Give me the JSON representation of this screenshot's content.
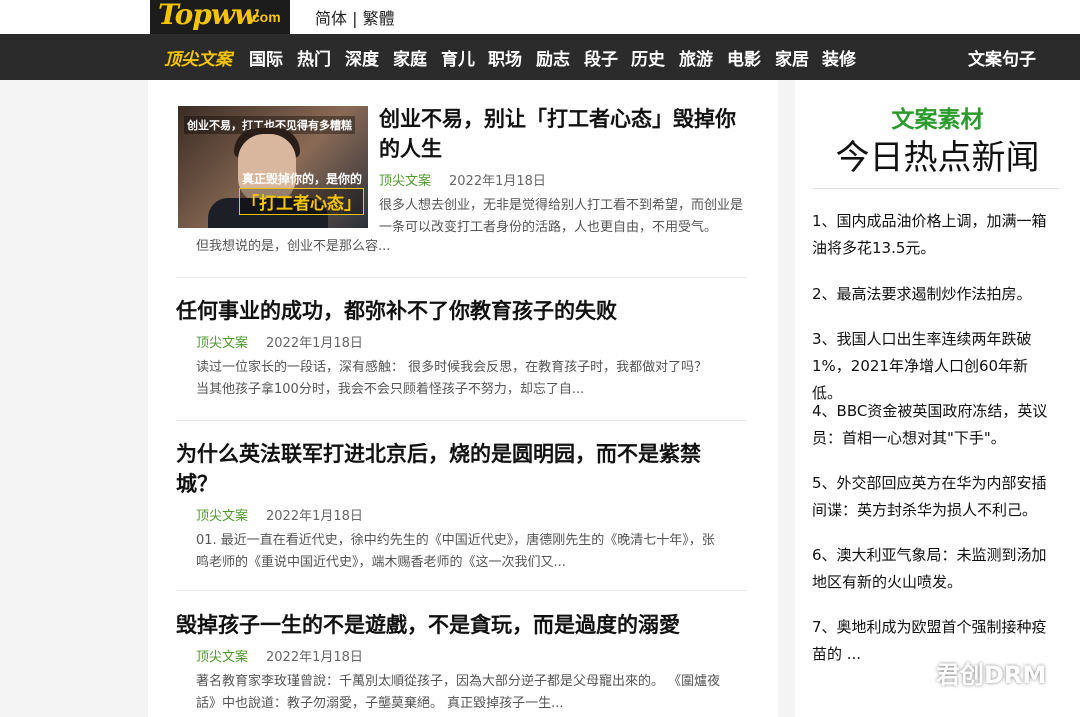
{
  "logo": {
    "main": "Topww",
    "suffix": ".com"
  },
  "language": {
    "simplified": "简体",
    "separator": " | ",
    "traditional": "繁體"
  },
  "nav": {
    "brand": "顶尖文案",
    "items": [
      "国际",
      "热门",
      "深度",
      "家庭",
      "育儿",
      "职场",
      "励志",
      "段子",
      "历史",
      "旅游",
      "电影",
      "家居",
      "装修"
    ],
    "right": "文案句子"
  },
  "thumbnail": {
    "top_text": "创业不易，打工也不见得有多糟糕",
    "mid_text": "真正毁掉你的，是你的",
    "highlight_text": "「打工者心态」"
  },
  "articles": [
    {
      "title": "创业不易，别让「打工者心态」毁掉你的人生",
      "source": "顶尖文案",
      "date": "2022年1月18日",
      "excerpt1": "很多人想去创业，无非是觉得给别人打工看不到希望，而创业是一条可以改变打工者身份的活路，人也更自由，不用受气。",
      "excerpt2": "但我想说的是，创业不是那么容..."
    },
    {
      "title": "任何事业的成功，都弥补不了你教育孩子的失败",
      "source": "顶尖文案",
      "date": "2022年1月18日",
      "excerpt": "读过一位家长的一段话，深有感触：  很多时候我会反思，在教育孩子时，我都做对了吗？ 当其他孩子拿100分时，我会不会只顾着怪孩子不努力，却忘了自..."
    },
    {
      "title": "为什么英法联军打进北京后，烧的是圆明园，而不是紫禁城？",
      "source": "顶尖文案",
      "date": "2022年1月18日",
      "excerpt": "01. 最近一直在看近代史，徐中约先生的《中国近代史》，唐德刚先生的《晚清七十年》，张鸣老师的《重说中国近代史》，端木赐香老师的《这一次我们又..."
    },
    {
      "title": "毁掉孩子一生的不是遊戲，不是貪玩，而是過度的溺愛",
      "source": "顶尖文案",
      "date": "2022年1月18日",
      "excerpt": "著名教育家李玫瑾曾說：千萬別太順從孩子，因為大部分逆子都是父母寵出來的。 《圍爐夜話》中也說道：教子勿溺愛，子壟莫棄絕。 真正毀掉孩子一生..."
    }
  ],
  "sidebar": {
    "heading_top": "文案素材",
    "heading_main": "今日热点新闻",
    "news": [
      "1、国内成品油价格上调，加满一箱油将多花13.5元。",
      "2、最高法要求遏制炒作法拍房。",
      "3、我国人口出生率连续两年跌破1%，2021年净增人口创60年新低。",
      "4、BBC资金被英国政府冻结，英议员：首相一心想对其\"下手\"。",
      "5、外交部回应英方在华为内部安插间谍：英方封杀华为损人不利己。",
      "6、澳大利亚气象局：未监测到汤加地区有新的火山喷发。",
      "7、奥地利成为欧盟首个强制接种疫苗的 ..."
    ]
  },
  "watermark": {
    "text": "君创DRM"
  },
  "colors": {
    "accent": "#f5c400",
    "nav_bg": "#2b2b2b",
    "source_green": "#4d9a2b",
    "sidebar_green": "#2d9a2d"
  }
}
